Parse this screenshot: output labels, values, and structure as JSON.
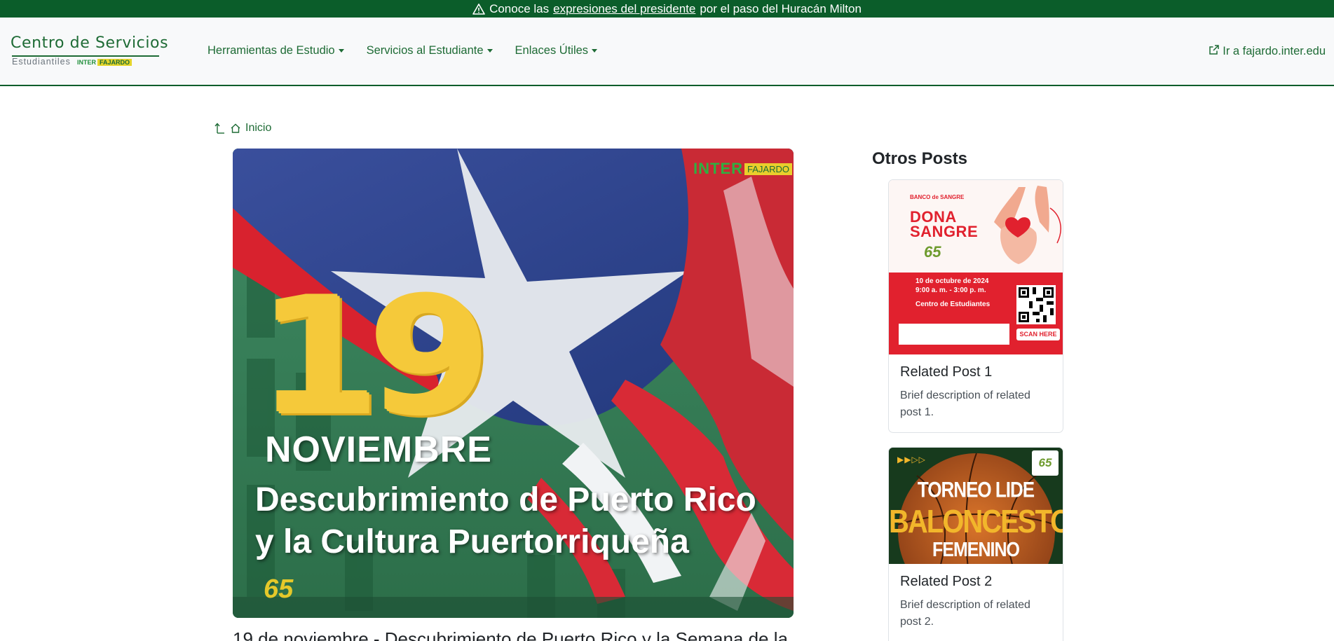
{
  "alert": {
    "prefix": "Conoce las",
    "link": "expresiones del presidente",
    "suffix": "por el paso del Huracán Milton"
  },
  "brand": {
    "title": "Centro de Servicios",
    "subtitle": "Estudiantiles",
    "badge_inter": "INTER",
    "badge_fajardo": "FAJARDO"
  },
  "nav": {
    "items": [
      {
        "label": "Herramientas de Estudio"
      },
      {
        "label": "Servicios al Estudiante"
      },
      {
        "label": "Enlaces Útiles"
      }
    ],
    "external_link": "Ir a fajardo.inter.edu"
  },
  "breadcrumb": {
    "home_label": "Inicio"
  },
  "hero": {
    "logo_inter": "INTER",
    "logo_fajardo": "FAJARDO",
    "day": "19",
    "month": "NOVIEMBRE",
    "line1": "Descubrimiento de Puerto Rico",
    "line2": "y la Cultura Puertorriqueña",
    "anniversary": "65"
  },
  "article": {
    "title": "19 de noviembre - Descubrimiento de Puerto Rico y la Semana de la"
  },
  "sidebar": {
    "title": "Otros Posts",
    "posts": [
      {
        "title": "Related Post 1",
        "description": "Brief description of related post 1.",
        "thumb": {
          "bank": "BANCO de SANGRE",
          "headline1": "DONA",
          "headline2": "SANGRE",
          "anniversary": "65",
          "date": "10 de octubre de 2024",
          "time": "9:00 a. m. - 3:00 p. m.",
          "place": "Centro de Estudiantes",
          "scan": "SCAN HERE"
        }
      },
      {
        "title": "Related Post 2",
        "description": "Brief description of related post 2.",
        "thumb": {
          "line1": "TORNEO LIDE",
          "line2": "BALONCESTO",
          "line3": "FEMENINO",
          "arrows": "▶▶▷▷",
          "anniversary": "65"
        }
      }
    ]
  },
  "colors": {
    "brand_green": "#0b5d2a",
    "link_green": "#1e6b35",
    "accent_yellow": "#e5c82a",
    "donate_red": "#e1212e"
  }
}
